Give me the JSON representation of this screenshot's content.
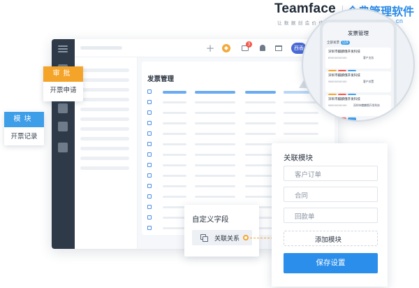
{
  "brand": {
    "name": "Teamface",
    "slogan": "让数据创造价值",
    "product_cn": "企典管理软件",
    "url": "www.teamface.cn"
  },
  "window": {
    "topbar": {
      "icons": [
        "plus-icon",
        "tag-icon",
        "mail-icon",
        "bell-icon",
        "book-icon",
        "avatar"
      ],
      "mail_badge": "3",
      "avatar_label": "西香"
    },
    "content_title": "发票管理"
  },
  "approve_callout": {
    "header": "审批",
    "item": "开票申请"
  },
  "module_callout": {
    "header": "模块",
    "item": "开票记录"
  },
  "phone": {
    "title": "发票管理",
    "filter": "全部发票",
    "filter_tag": "已开",
    "cards": [
      {
        "title": "深圳市麒麟俄开发科技",
        "left": "89000000000",
        "right": "客户业务"
      },
      {
        "title": "深圳市麒麟俄开发科技",
        "left": "98000000000",
        "right": "客户处置"
      },
      {
        "title": "深圳市麒麟俄开发科技",
        "left": "98000000000",
        "right": "深圳市麒麟俄开发科技"
      }
    ]
  },
  "custom_field": {
    "title": "自定义字段",
    "chip": "关联关系"
  },
  "related_module": {
    "title": "关联模块",
    "items": [
      "客户订单",
      "合同",
      "回款单"
    ],
    "add": "添加模块",
    "save": "保存设置"
  },
  "colors": {
    "accent_blue": "#2a8eea",
    "accent_orange": "#f5a42a",
    "sidebar": "#2e3a48"
  }
}
